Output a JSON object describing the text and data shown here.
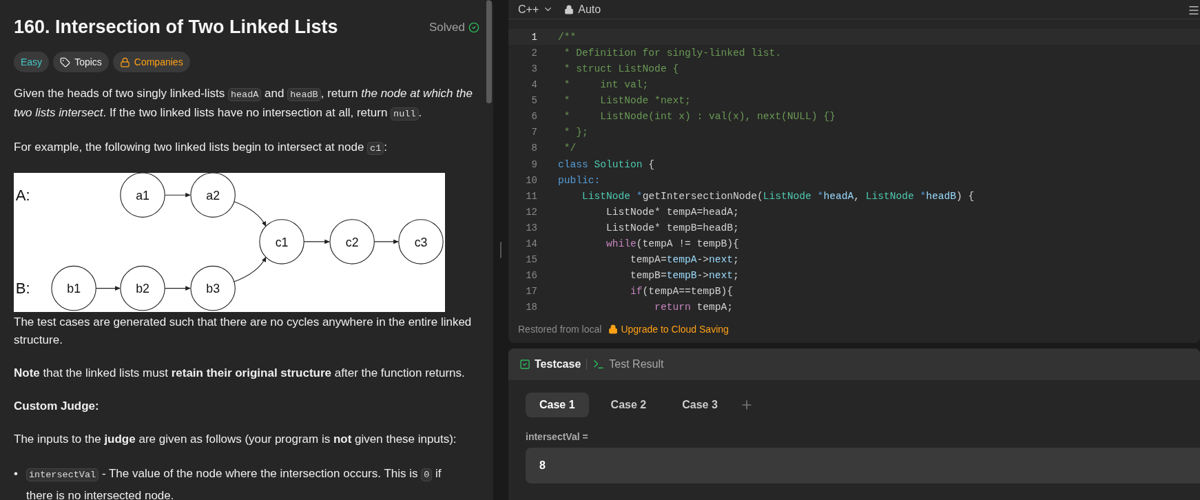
{
  "problem": {
    "title": "160. Intersection of Two Linked Lists",
    "status": "Solved",
    "tags": [
      {
        "kind": "difficulty",
        "label": "Easy"
      },
      {
        "kind": "topics",
        "label": "Topics"
      },
      {
        "kind": "companies",
        "label": "Companies"
      }
    ],
    "intro": [
      [
        {
          "kind": "text",
          "t": "Given the heads of two singly linked-lists "
        },
        {
          "kind": "code",
          "t": "headA"
        },
        {
          "kind": "text",
          "t": " and "
        },
        {
          "kind": "code",
          "t": "headB"
        },
        {
          "kind": "text",
          "t": ", return *the node at which the two lists intersect*. If the two linked lists have no intersection at all, return "
        },
        {
          "kind": "code",
          "t": "null"
        },
        {
          "kind": "text",
          "t": "."
        }
      ],
      [
        {
          "kind": "text",
          "t": "For example, the following two linked lists begin to intersect at node "
        },
        {
          "kind": "code",
          "t": "c1"
        },
        {
          "kind": "text",
          "t": ":"
        }
      ]
    ],
    "diagram": {
      "list_labels": [
        "A:",
        "B:"
      ],
      "nodes": [
        "a1",
        "a2",
        "c1",
        "c2",
        "c3",
        "b1",
        "b2",
        "b3"
      ]
    },
    "body": [
      [
        {
          "kind": "text",
          "t": "The test cases are generated such that there are no cycles anywhere in the entire linked structure."
        }
      ],
      [
        {
          "kind": "text",
          "t": "**Note** that the linked lists must **retain their original structure** after the function returns."
        }
      ],
      [
        {
          "kind": "text",
          "t": "**Custom Judge:**"
        }
      ],
      [
        {
          "kind": "text",
          "t": "The inputs to the **judge** are given as follows (your program is **not** given these inputs):"
        }
      ]
    ],
    "bullets": [
      {
        "marker": "•",
        "text": [
          {
            "kind": "code",
            "t": "intersectVal"
          },
          {
            "kind": "text",
            "t": " - The value of the node where the intersection occurs. This is "
          },
          {
            "kind": "code",
            "t": "0"
          },
          {
            "kind": "text",
            "t": " if there is no intersected node."
          }
        ]
      }
    ]
  },
  "editor": {
    "language": "C++",
    "mode": "Auto",
    "lines": [
      {
        "n": "1",
        "active": true,
        "tokens": [
          {
            "kind": "comment",
            "t": "/**"
          }
        ]
      },
      {
        "n": "2",
        "active": false,
        "tokens": [
          {
            "kind": "comment",
            "t": " * Definition for singly-linked list."
          }
        ]
      },
      {
        "n": "3",
        "active": false,
        "tokens": [
          {
            "kind": "comment",
            "t": " * struct ListNode {"
          }
        ]
      },
      {
        "n": "4",
        "active": false,
        "tokens": [
          {
            "kind": "comment",
            "t": " *     int val;"
          }
        ]
      },
      {
        "n": "5",
        "active": false,
        "tokens": [
          {
            "kind": "comment",
            "t": " *     ListNode *next;"
          }
        ]
      },
      {
        "n": "6",
        "active": false,
        "tokens": [
          {
            "kind": "comment",
            "t": " *     ListNode(int x) : val(x), next(NULL) {}"
          }
        ]
      },
      {
        "n": "7",
        "active": false,
        "tokens": [
          {
            "kind": "comment",
            "t": " * };"
          }
        ]
      },
      {
        "n": "8",
        "active": false,
        "tokens": [
          {
            "kind": "comment",
            "t": " */"
          }
        ]
      },
      {
        "n": "9",
        "active": false,
        "tokens": [
          {
            "kind": "keyword",
            "t": "class "
          },
          {
            "kind": "type",
            "t": "Solution"
          },
          {
            "kind": "plain",
            "t": " {"
          }
        ]
      },
      {
        "n": "10",
        "active": false,
        "tokens": [
          {
            "kind": "keyword",
            "t": "public:"
          }
        ]
      },
      {
        "n": "11",
        "active": false,
        "tokens": [
          {
            "kind": "type",
            "t": "    ListNode "
          },
          {
            "kind": "keyword",
            "t": "*"
          },
          {
            "kind": "plain",
            "t": "getIntersectionNode("
          },
          {
            "kind": "type",
            "t": "ListNode "
          },
          {
            "kind": "keyword",
            "t": "*"
          },
          {
            "kind": "param",
            "t": "headA"
          },
          {
            "kind": "plain",
            "t": ", "
          },
          {
            "kind": "type",
            "t": "ListNode "
          },
          {
            "kind": "keyword",
            "t": "*"
          },
          {
            "kind": "param",
            "t": "headB"
          },
          {
            "kind": "plain",
            "t": ") {"
          }
        ]
      },
      {
        "n": "12",
        "active": false,
        "tokens": [
          {
            "kind": "plain",
            "t": "        ListNode* tempA=headA;"
          }
        ]
      },
      {
        "n": "13",
        "active": false,
        "tokens": [
          {
            "kind": "plain",
            "t": "        ListNode* tempB=headB;"
          }
        ]
      },
      {
        "n": "14",
        "active": false,
        "tokens": [
          {
            "kind": "control",
            "t": "        while"
          },
          {
            "kind": "plain",
            "t": "(tempA != tempB){"
          }
        ]
      },
      {
        "n": "15",
        "active": false,
        "tokens": [
          {
            "kind": "plain",
            "t": "            tempA="
          },
          {
            "kind": "param",
            "t": "tempA"
          },
          {
            "kind": "plain",
            "t": "->"
          },
          {
            "kind": "param",
            "t": "next"
          },
          {
            "kind": "plain",
            "t": ";"
          }
        ]
      },
      {
        "n": "16",
        "active": false,
        "tokens": [
          {
            "kind": "plain",
            "t": "            tempB="
          },
          {
            "kind": "param",
            "t": "tempB"
          },
          {
            "kind": "plain",
            "t": "->"
          },
          {
            "kind": "param",
            "t": "next"
          },
          {
            "kind": "plain",
            "t": ";"
          }
        ]
      },
      {
        "n": "17",
        "active": false,
        "tokens": [
          {
            "kind": "control",
            "t": "            if"
          },
          {
            "kind": "plain",
            "t": "(tempA==tempB){"
          }
        ]
      },
      {
        "n": "18",
        "active": false,
        "tokens": [
          {
            "kind": "control",
            "t": "                return"
          },
          {
            "kind": "plain",
            "t": " tempA;"
          }
        ]
      }
    ],
    "status": "Restored from local",
    "upgrade": "Upgrade to Cloud Saving"
  },
  "testpanel": {
    "tabs": [
      {
        "kind": "testcase",
        "label": "Testcase",
        "selected": true
      },
      {
        "kind": "result",
        "label": "Test Result",
        "selected": false
      }
    ],
    "cases": [
      {
        "label": "Case 1",
        "selected": true
      },
      {
        "label": "Case 2",
        "selected": false
      },
      {
        "label": "Case 3",
        "selected": false
      }
    ],
    "inputs": [
      {
        "label": "intersectVal =",
        "value": "8"
      }
    ]
  }
}
